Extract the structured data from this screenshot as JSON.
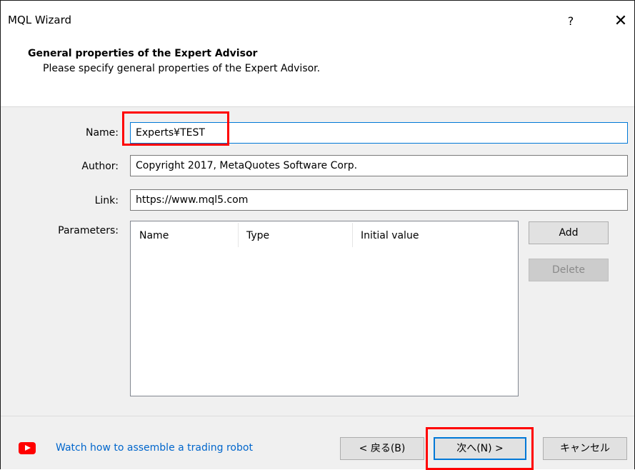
{
  "window": {
    "title": "MQL Wizard",
    "help_label": "?",
    "close_label": "✕"
  },
  "header": {
    "title": "General properties of the Expert Advisor",
    "subtitle": "Please specify general properties of the Expert Advisor."
  },
  "form": {
    "name_label": "Name:",
    "name_value": "Experts¥TEST",
    "author_label": "Author:",
    "author_value": "Copyright 2017, MetaQuotes Software Corp.",
    "link_label": "Link:",
    "link_value": "https://www.mql5.com",
    "parameters_label": "Parameters:"
  },
  "parameters_table": {
    "columns": [
      "Name",
      "Type",
      "Initial value"
    ]
  },
  "side_buttons": {
    "add": "Add",
    "delete": "Delete"
  },
  "footer": {
    "video_link": "Watch how to assemble a trading robot",
    "back_button": "< 戻る(B)",
    "next_button": "次へ(N) >",
    "cancel_button": "キャンセル"
  },
  "colors": {
    "accent": "#0078d7",
    "link": "#0066cc",
    "highlight": "#ff0000",
    "youtube": "#ff0000"
  }
}
